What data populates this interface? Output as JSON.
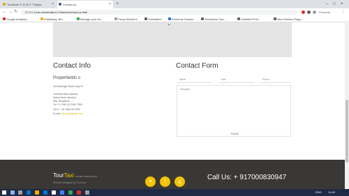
{
  "browser": {
    "tabs": [
      {
        "label": "TourDeal: IT & SCT: Tutopia",
        "active": false
      },
      {
        "label": "Contact us",
        "active": true
      }
    ],
    "new_tab": "+",
    "url": "27.0.0.1/car-rental/cabs-in-Ontario/contact-us.html",
    "account_label": "Personal",
    "bookmarks": [
      "Google Analytics",
      "Publishing, Blo...",
      "Manage your for...",
      "Fancy Mobile A...",
      "Translation",
      "Shortcuts Downlo...",
      "Wordpress Tips ...",
      "Unlimited Prof...",
      "New Window Page..."
    ]
  },
  "contact_info": {
    "title": "Contact Info",
    "company": "Propertiedds o",
    "address_line": "45 Madhugiri Street Jaya Pl",
    "lines": [
      "TourDeal Raw address",
      "Malad West, Mumbai",
      "Dist. Bangalore - ...",
      "Tel: +1 2345 (2) 3456 7890",
      "CELL: +91 9960 80 0000"
    ],
    "email_label": "E-mail:",
    "email": "ptc.info@gmail.com"
  },
  "contact_form": {
    "title": "Contact Form",
    "fields": {
      "name": "Name",
      "email": "Mail",
      "phone": "Phone"
    },
    "message_placeholder": "Message",
    "send_label": "Submit"
  },
  "footer": {
    "brand_main": "Tour",
    "brand_accent": "Taxi",
    "brand_tag": "Our Best Travel Partner",
    "copyright": "Website Designed by TourTaxi",
    "call_label": "Call Us: + 917000830947",
    "social": [
      "twitter-icon",
      "facebook-icon",
      "google-plus-icon"
    ]
  },
  "taskbar": {
    "tray_text": "ENG",
    "time": "11:48"
  },
  "colors": {
    "accent": "#f4c300",
    "footer_bg": "#3a3836",
    "map_bg": "#e5e5e5"
  }
}
